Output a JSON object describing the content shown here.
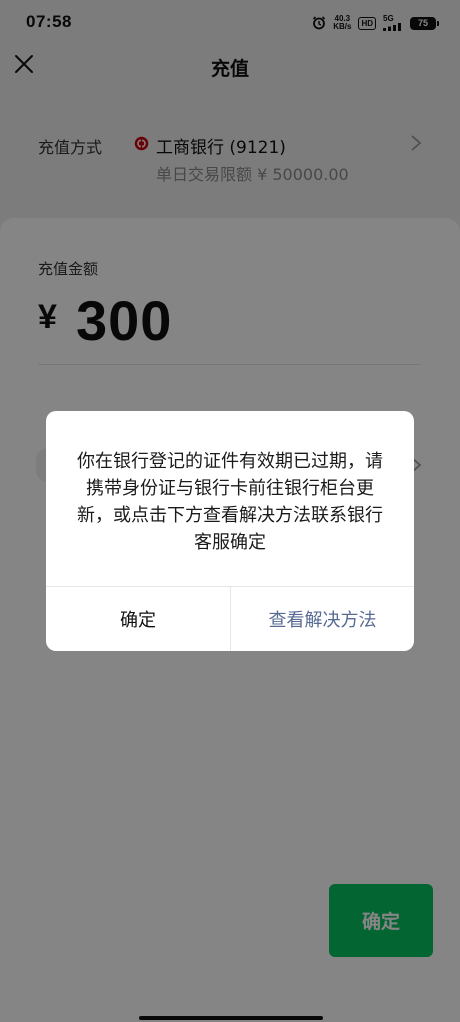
{
  "status_bar": {
    "time": "07:58",
    "net_speed_value": "40.3",
    "net_speed_unit": "KB/s",
    "hd_label": "HD",
    "network_type": "5G",
    "battery_level": "75"
  },
  "nav": {
    "title": "充值",
    "close_icon": "close-icon"
  },
  "payment_method": {
    "label": "充值方式",
    "bank_name": "工商银行 (9121)",
    "daily_limit": "单日交易限额 ¥ 50000.00",
    "bank_icon": "icbc-logo-icon"
  },
  "amount": {
    "label": "充值金额",
    "currency_symbol": "¥",
    "value": "300"
  },
  "confirm_button_label": "确定",
  "dialog": {
    "message": "你在银行登记的证件有效期已过期，请携带身份证与银行卡前往银行柜台更新，或点击下方查看解决方法联系银行客服确定",
    "ok_label": "确定",
    "solution_label": "查看解决方法"
  },
  "colors": {
    "primary_green": "#07c160",
    "link_blue": "#576b95",
    "icbc_red": "#c7000b"
  }
}
